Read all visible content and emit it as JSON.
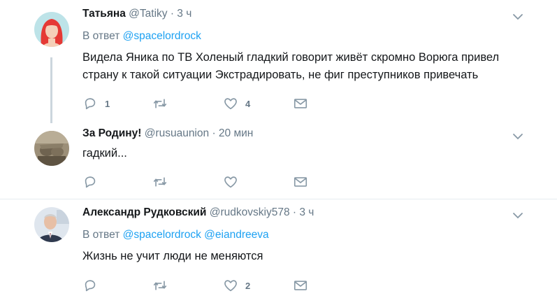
{
  "tweets": [
    {
      "name": "Татьяна",
      "handle": "@Tatiky",
      "time": "· 3 ч",
      "reply_prefix": "В ответ",
      "mentions": [
        "@spacelordrock"
      ],
      "text_lines": [
        "Видела Яника по ТВ Холеный гладкий говорит живёт скромно Ворюга привел",
        "страну к такой ситуации Экстрадировать, не фиг преступников привечать"
      ],
      "reply_count": "1",
      "retweet_count": "",
      "like_count": "4"
    },
    {
      "name": "За Родину!",
      "handle": "@rusuaunion",
      "time": "· 20 мин",
      "text_lines": [
        "гадкий..."
      ],
      "reply_count": "",
      "retweet_count": "",
      "like_count": ""
    },
    {
      "name": "Александр Рудковский",
      "handle": "@rudkovskiy578",
      "time": "· 3 ч",
      "reply_prefix": "В ответ",
      "mentions": [
        "@spacelordrock",
        "@eiandreeva"
      ],
      "text_lines": [
        "Жизнь не учит люди не меняются"
      ],
      "reply_count": "",
      "retweet_count": "",
      "like_count": "2"
    }
  ],
  "icons": {
    "reply": "reply-icon",
    "retweet": "retweet-icon",
    "like": "heart-icon",
    "dm": "envelope-icon",
    "more": "chevron-down-icon"
  },
  "colors": {
    "accent": "#1da1f2",
    "muted": "#657786",
    "thread_line": "#ccd6dd"
  }
}
